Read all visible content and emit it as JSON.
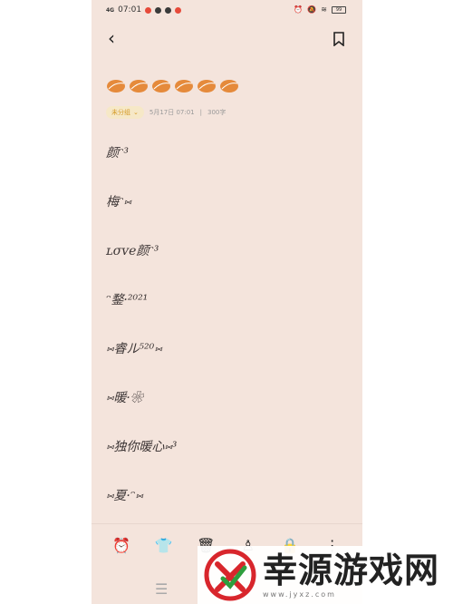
{
  "status_bar": {
    "network": "4G",
    "time": "07:01",
    "battery": "99"
  },
  "note": {
    "category": "未分组",
    "date": "5月17日 07:01",
    "separator": "|",
    "word_count": "300字",
    "lines": [
      "颜ᵔ³",
      "梅ᵔ⑅",
      "ʟσᴠe颜ᵔ³",
      "ᵔ鍪·²⁰²¹",
      "⑅睿ル⁵²⁰⑅",
      "⑅暖·❀",
      "⑅独你暖心⑅³",
      "⑅夏·ᵔ⑅"
    ]
  },
  "icons": {
    "back": "‹",
    "alarm": "⏰",
    "shirt": "👕",
    "trash": "🗑",
    "more": "⋮",
    "nav": "☰"
  },
  "watermark": {
    "title": "幸源游戏网",
    "url": "www.jyxz.com"
  }
}
